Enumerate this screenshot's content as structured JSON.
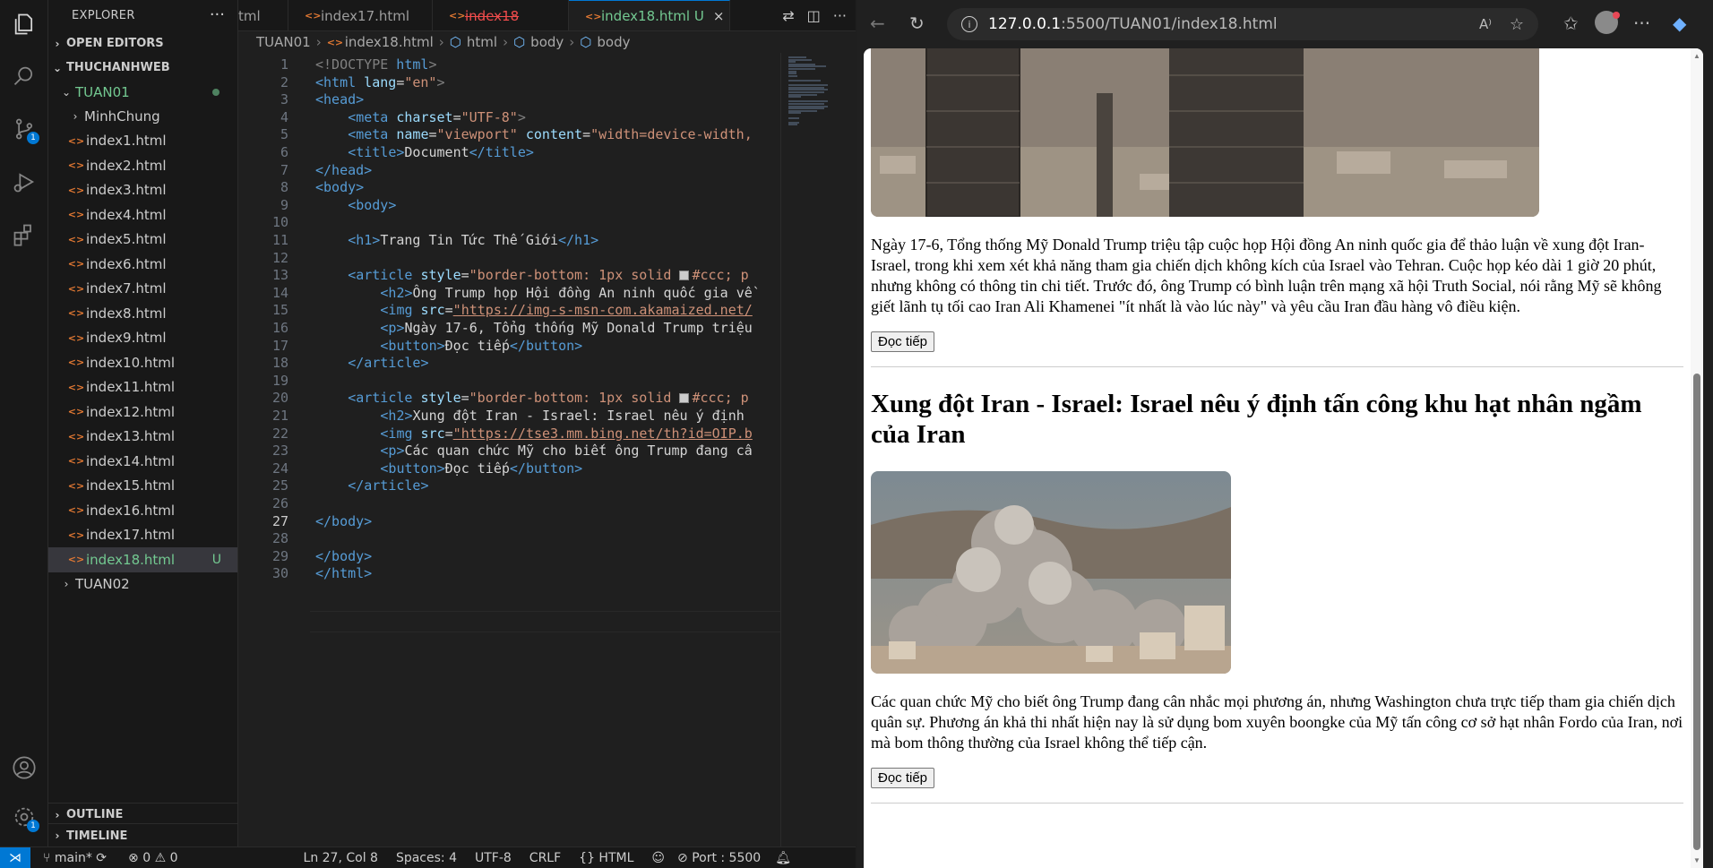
{
  "vscode": {
    "explorer_title": "EXPLORER",
    "sections": {
      "open_editors": "OPEN EDITORS",
      "workspace": "THUCHANHWEB",
      "outline": "OUTLINE",
      "timeline": "TIMELINE"
    },
    "folders": {
      "tuan01": "TUAN01",
      "minhchung": "MinhChung",
      "tuan02": "TUAN02"
    },
    "files": [
      "index1.html",
      "index2.html",
      "index3.html",
      "index4.html",
      "index5.html",
      "index6.html",
      "index7.html",
      "index8.html",
      "index9.html",
      "index10.html",
      "index11.html",
      "index12.html",
      "index13.html",
      "index14.html",
      "index15.html",
      "index16.html",
      "index17.html",
      "index18.html"
    ],
    "selected_file_status": "U",
    "scm_badge": "1",
    "settings_badge": "1",
    "tabs": [
      {
        "label": "tml"
      },
      {
        "label": "index17.html"
      },
      {
        "label": "index18"
      },
      {
        "label": "index18.html",
        "status": "U",
        "close": "×"
      }
    ],
    "breadcrumb": {
      "folder": "TUAN01",
      "file": "index18.html",
      "html": "html",
      "body1": "body",
      "body2": "body"
    },
    "line_numbers": [
      "1",
      "2",
      "3",
      "4",
      "5",
      "6",
      "7",
      "8",
      "9",
      "10",
      "11",
      "12",
      "13",
      "14",
      "15",
      "16",
      "17",
      "18",
      "19",
      "20",
      "21",
      "22",
      "23",
      "24",
      "25",
      "26",
      "27",
      "28",
      "29",
      "30"
    ],
    "code": {
      "doctype_open": "<!DOCTYPE",
      "doctype_kw": " html",
      "doctype_close": ">",
      "html_lang_tag": "<html",
      "lang_attr": " lang",
      "lang_val": "\"en\"",
      "head_open": "<head>",
      "meta": "<meta",
      "charset_attr": " charset",
      "charset_val": "\"UTF-8\"",
      "name_attr": " name",
      "viewport_val": "\"viewport\"",
      "content_attr": " content",
      "content_val": "\"width=device-width,",
      "title_open": "<title>",
      "title_text": "Document",
      "title_close": "</title>",
      "head_close": "</head>",
      "body_open": "<body>",
      "h1_open": "<h1>",
      "h1_text": "Trang Tin Tức Thế Giới",
      "h1_close": "</h1>",
      "article_open": "<article",
      "style_attr": " style",
      "style_val_a": "\"border-bottom: 1px solid ",
      "style_val_b": "#ccc; p",
      "h2_open": "<h2>",
      "h2_text_1": "Ông Trump họp Hội đồng An ninh quốc gia về",
      "h2_text_2": "Xung đột Iran - Israel: Israel nêu ý định",
      "img_open": "<img",
      "src_attr": " src",
      "src_1": "\"https://img-s-msn-com.akamaized.net/",
      "src_2": "\"https://tse3.mm.bing.net/th?id=OIP.b",
      "p_open": "<p>",
      "p_text_1": "Ngày 17-6, Tổng thống Mỹ Donald Trump triệu",
      "p_text_2": "Các quan chức Mỹ cho biết ông Trump đang câ",
      "button_open": "<button>",
      "button_text": "Đọc tiếp",
      "button_close": "</button>",
      "article_close": "</article>",
      "body_close": "</body>",
      "html_close": "</html>"
    },
    "status": {
      "branch": "main*",
      "errors": "0",
      "warnings": "0",
      "position": "Ln 27, Col 8",
      "spaces": "Spaces: 4",
      "encoding": "UTF-8",
      "eol": "CRLF",
      "language": "HTML",
      "port": "Port : 5500"
    }
  },
  "browser": {
    "url_host": "127.0.0.1",
    "url_path": ":5500/TUAN01/index18.html",
    "articles": [
      {
        "paragraph": "Ngày 17-6, Tổng thống Mỹ Donald Trump triệu tập cuộc họp Hội đồng An ninh quốc gia để thảo luận về xung đột Iran-Israel, trong khi xem xét khả năng tham gia chiến dịch không kích của Israel vào Tehran. Cuộc họp kéo dài 1 giờ 20 phút, nhưng không có thông tin chi tiết. Trước đó, ông Trump có bình luận trên mạng xã hội Truth Social, nói rằng Mỹ sẽ không giết lãnh tụ tối cao Iran Ali Khamenei \"ít nhất là vào lúc này\" và yêu cầu Iran đầu hàng vô điều kiện.",
        "button": "Đọc tiếp"
      },
      {
        "heading": "Xung đột Iran - Israel: Israel nêu ý định tấn công khu hạt nhân ngầm của Iran",
        "paragraph": "Các quan chức Mỹ cho biết ông Trump đang cân nhắc mọi phương án, nhưng Washington chưa trực tiếp tham gia chiến dịch quân sự. Phương án khả thi nhất hiện nay là sử dụng bom xuyên boongke của Mỹ tấn công cơ sở hạt nhân Fordo của Iran, nơi mà bom thông thường của Israel không thể tiếp cận.",
        "button": "Đọc tiếp"
      }
    ]
  }
}
